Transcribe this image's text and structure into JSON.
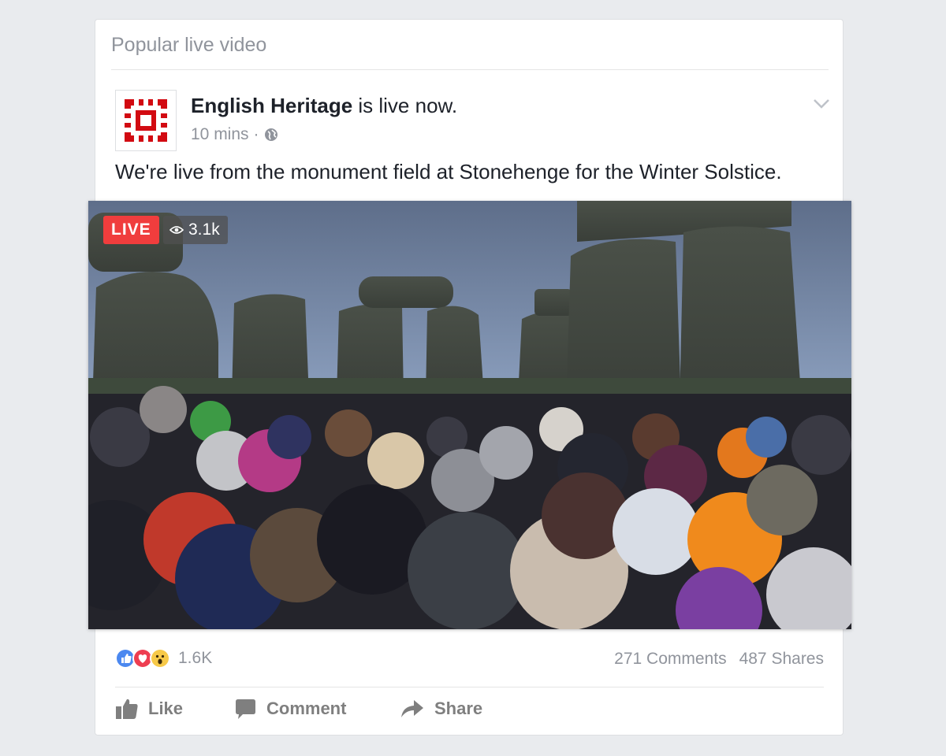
{
  "section": {
    "title": "Popular live video"
  },
  "post": {
    "author": "English Heritage",
    "status_text": " is live now.",
    "time": "10 mins",
    "separator": "·",
    "text": "We're live from the monument field at Stonehenge for the Winter Solstice."
  },
  "video": {
    "live_label": "LIVE",
    "viewers": "3.1k",
    "live_color": "#f03d3d"
  },
  "reactions": {
    "icons": [
      "like-icon",
      "love-icon",
      "wow-icon"
    ],
    "count": "1.6K"
  },
  "engagement": {
    "comments": "271 Comments",
    "shares": "487 Shares"
  },
  "actions": {
    "like": "Like",
    "comment": "Comment",
    "share": "Share"
  },
  "colors": {
    "brand_red": "#d20a11",
    "like_blue": "#4b88f0",
    "love_red": "#ee3e51",
    "wow_yellow": "#f7c948"
  }
}
